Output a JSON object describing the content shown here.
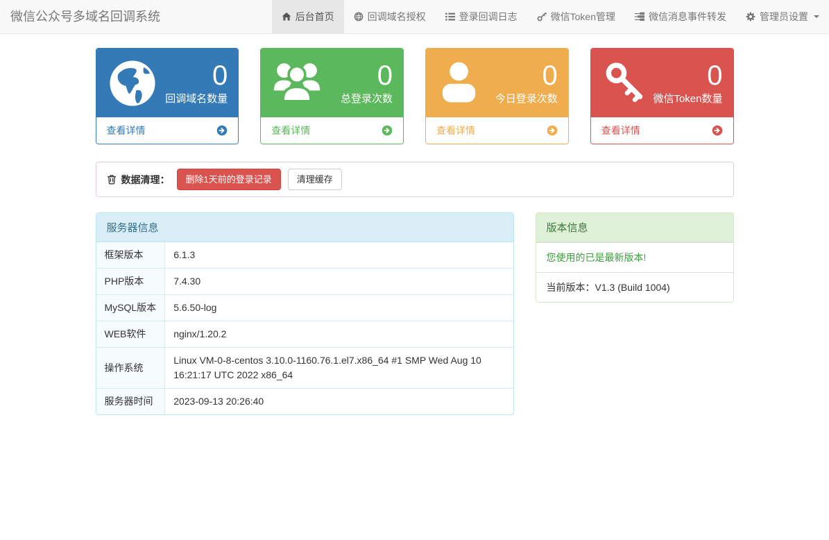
{
  "brand": "微信公众号多域名回调系统",
  "nav": {
    "items": [
      {
        "label": "后台首页",
        "icon": "home-icon",
        "active": true
      },
      {
        "label": "回调域名授权",
        "icon": "globe-icon",
        "active": false
      },
      {
        "label": "登录回调日志",
        "icon": "list-icon",
        "active": false
      },
      {
        "label": "微信Token管理",
        "icon": "key-icon",
        "active": false
      },
      {
        "label": "微信消息事件转发",
        "icon": "tasks-icon",
        "active": false
      },
      {
        "label": "管理员设置",
        "icon": "gear-icon",
        "active": false,
        "dropdown": true
      }
    ]
  },
  "stats": {
    "cards": [
      {
        "value": "0",
        "label": "回调域名数量",
        "link_label": "查看详情",
        "icon": "globe-icon",
        "color": "#337ab7"
      },
      {
        "value": "0",
        "label": "总登录次数",
        "link_label": "查看详情",
        "icon": "users-icon",
        "color": "#5cb85c"
      },
      {
        "value": "0",
        "label": "今日登录次数",
        "link_label": "查看详情",
        "icon": "user-icon",
        "color": "#f0ad4e"
      },
      {
        "value": "0",
        "label": "微信Token数量",
        "link_label": "查看详情",
        "icon": "key-icon",
        "color": "#d9534f"
      }
    ]
  },
  "cleanup": {
    "label": "数据清理：",
    "delete_button": "删除1天前的登录记录",
    "cache_button": "清理缓存"
  },
  "server_info": {
    "title": "服务器信息",
    "rows": [
      {
        "label": "框架版本",
        "value": "6.1.3"
      },
      {
        "label": "PHP版本",
        "value": "7.4.30"
      },
      {
        "label": "MySQL版本",
        "value": "5.6.50-log"
      },
      {
        "label": "WEB软件",
        "value": "nginx/1.20.2"
      },
      {
        "label": "操作系统",
        "value": "Linux VM-0-8-centos 3.10.0-1160.76.1.el7.x86_64 #1 SMP Wed Aug 10 16:21:17 UTC 2022 x86_64"
      },
      {
        "label": "服务器时间",
        "value": "2023-09-13 20:26:40"
      }
    ]
  },
  "version_info": {
    "title": "版本信息",
    "status": "您使用的已是最新版本!",
    "current": "当前版本：V1.3 (Build 1004)"
  },
  "icons": {
    "home-icon": "house",
    "globe-icon": "globe",
    "list-icon": "bulleted list",
    "key-icon": "key",
    "tasks-icon": "task bars",
    "gear-icon": "gear",
    "caret-down-icon": "▾",
    "trash-icon": "trash can",
    "arrow-circle-right-icon": "circled right arrow",
    "users-icon": "user group",
    "user-icon": "person"
  },
  "colors": {
    "primary": "#337ab7",
    "success": "#5cb85c",
    "warning": "#f0ad4e",
    "danger": "#d9534f",
    "navbar_bg": "#f8f8f8",
    "navbar_active_bg": "#e7e7e7",
    "info_header_bg": "#d9edf7",
    "info_text": "#31708f",
    "success_header_bg": "#dff0d8",
    "success_text": "#3c763d",
    "danger_panel_border": "#ebccd1"
  }
}
